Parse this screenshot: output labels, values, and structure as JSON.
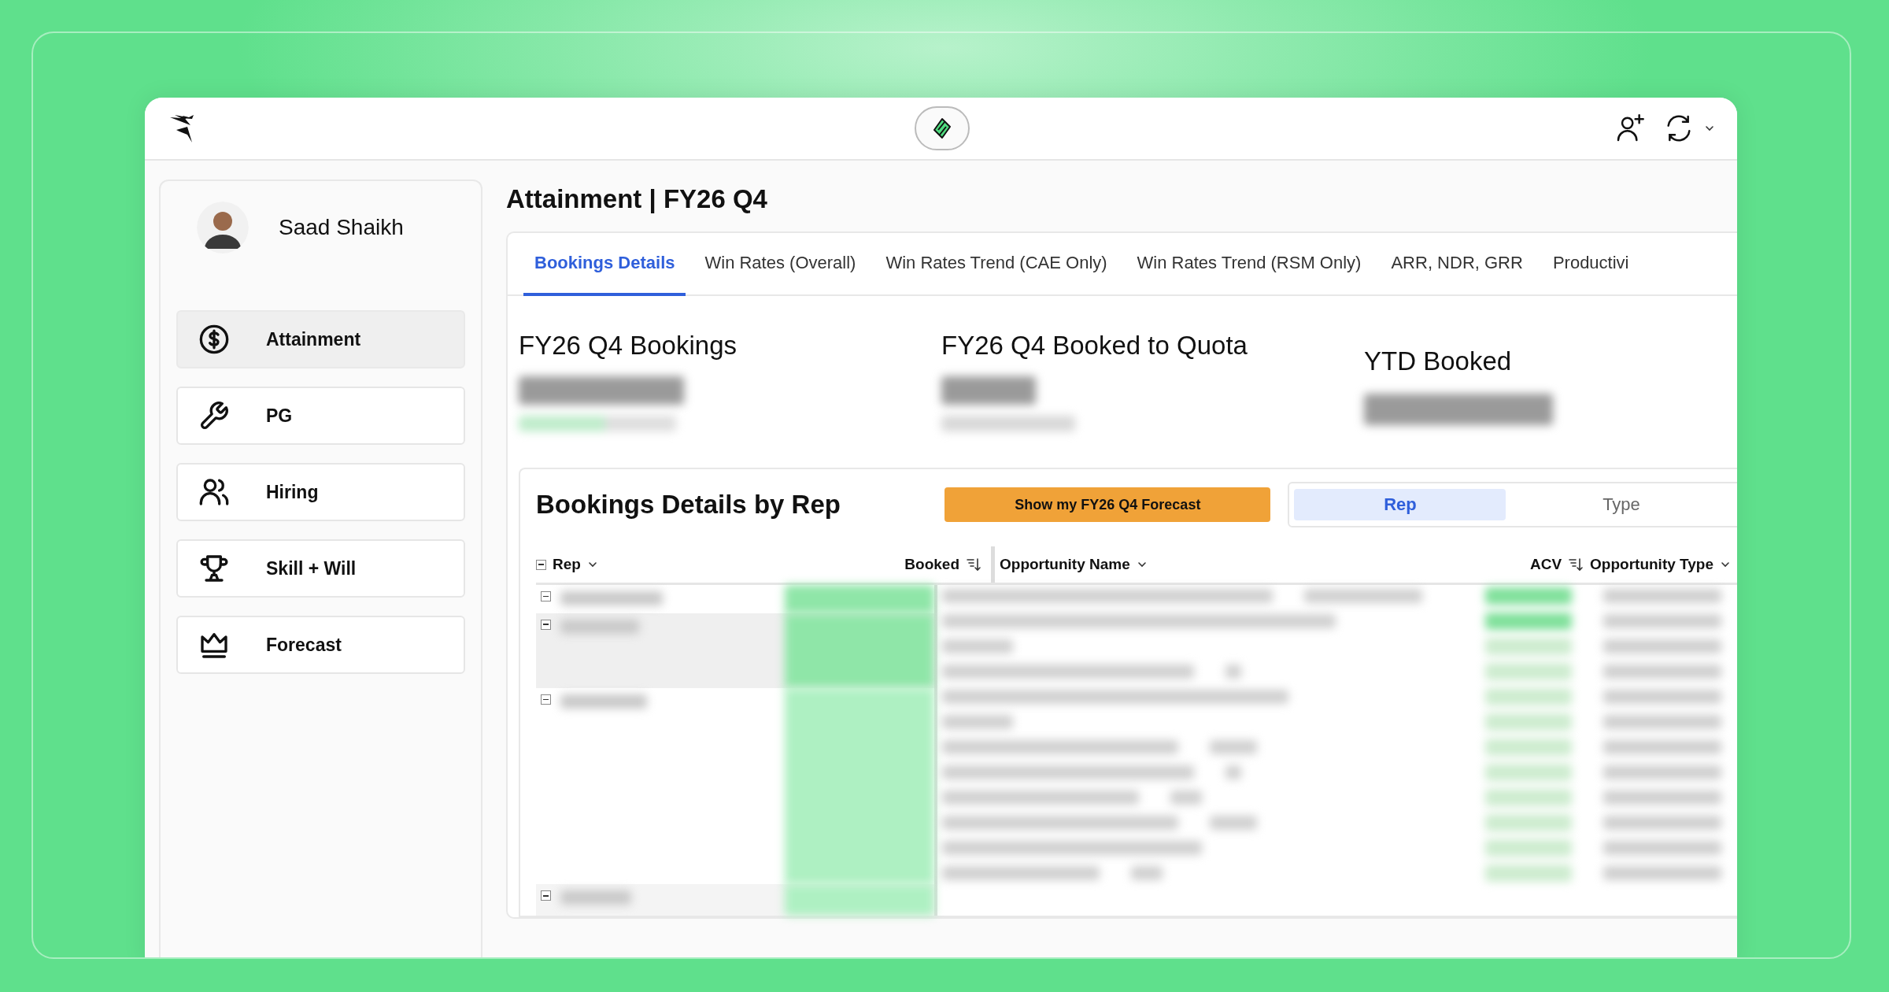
{
  "user": {
    "name": "Saad Shaikh"
  },
  "nav": [
    {
      "label": "Attainment",
      "selected": true
    },
    {
      "label": "PG",
      "selected": false
    },
    {
      "label": "Hiring",
      "selected": false
    },
    {
      "label": "Skill + Will",
      "selected": false
    },
    {
      "label": "Forecast",
      "selected": false
    }
  ],
  "page_title": "Attainment | FY26 Q4",
  "tabs": [
    {
      "label": "Bookings Details",
      "selected": true
    },
    {
      "label": "Win Rates (Overall)",
      "selected": false
    },
    {
      "label": "Win Rates Trend (CAE Only)",
      "selected": false
    },
    {
      "label": "Win Rates Trend (RSM Only)",
      "selected": false
    },
    {
      "label": "ARR, NDR, GRR",
      "selected": false
    },
    {
      "label": "Productivi",
      "selected": false
    }
  ],
  "kpis": [
    {
      "title": "FY26 Q4 Bookings"
    },
    {
      "title": "FY26 Q4 Booked to Quota"
    },
    {
      "title": "YTD Booked"
    }
  ],
  "bookings_table": {
    "title": "Bookings Details by Rep",
    "forecast_button": "Show my FY26 Q4 Forecast",
    "view_toggle": [
      {
        "label": "Rep",
        "selected": true
      },
      {
        "label": "Type",
        "selected": false
      }
    ],
    "columns": [
      {
        "label": "Rep",
        "kind": "menu"
      },
      {
        "label": "Booked",
        "kind": "sort"
      },
      {
        "label": "Opportunity Name",
        "kind": "menu"
      },
      {
        "label": "ACV",
        "kind": "sort"
      },
      {
        "label": "Opportunity Type",
        "kind": "menu"
      }
    ]
  }
}
